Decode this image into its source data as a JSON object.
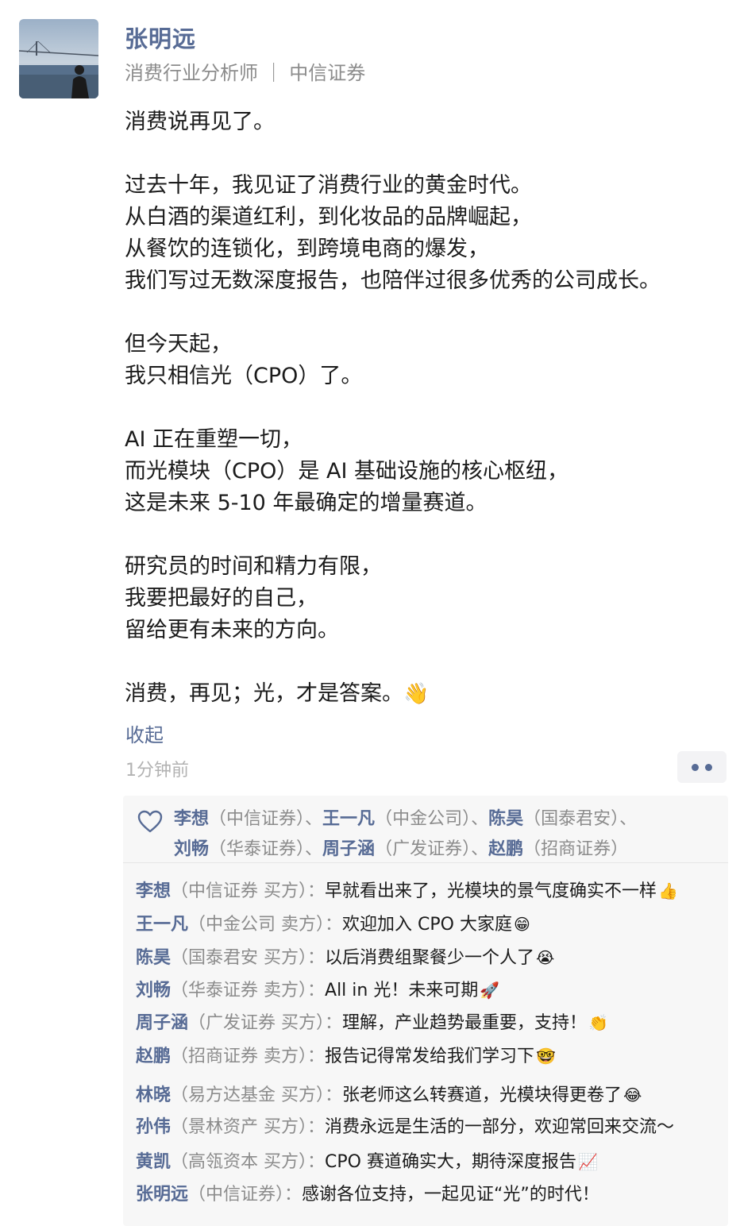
{
  "author": {
    "name": "张明远",
    "title": "消费行业分析师 ｜ 中信证券"
  },
  "post": {
    "paragraphs": [
      [
        "消费说再见了。"
      ],
      [
        "过去十年，我见证了消费行业的黄金时代。",
        "从白酒的渠道红利，到化妆品的品牌崛起，",
        "从餐饮的连锁化，到跨境电商的爆发，",
        "我们写过无数深度报告，也陪伴过很多优秀的公司成长。"
      ],
      [
        "但今天起，",
        "我只相信光（CPO）了。"
      ],
      [
        "AI 正在重塑一切，",
        "而光模块（CPO）是 AI 基础设施的核心枢纽，",
        "这是未来 5-10 年最确定的增量赛道。"
      ],
      [
        "研究员的时间和精力有限，",
        "我要把最好的自己，",
        "留给更有未来的方向。"
      ]
    ],
    "closing_line": "消费，再见；光，才是答案。",
    "closing_emoji": "👋",
    "collapse_label": "收起",
    "timestamp": "1分钟前"
  },
  "likes": {
    "line1": [
      {
        "name": "李想",
        "org": "（中信证券）"
      },
      {
        "name": "王一凡",
        "org": "（中金公司）"
      },
      {
        "name": "陈昊",
        "org": "（国泰君安）"
      }
    ],
    "line2": [
      {
        "name": "刘畅",
        "org": "（华泰证券）"
      },
      {
        "name": "周子涵",
        "org": "（广发证券）"
      },
      {
        "name": "赵鹏",
        "org": "（招商证券）"
      }
    ],
    "separator": "、"
  },
  "comments": [
    {
      "name": "李想",
      "org": "（中信证券 买方）：",
      "text": "早就看出来了，光模块的景气度确实不一样",
      "emoji": "👍"
    },
    {
      "name": "王一凡",
      "org": "（中金公司 卖方）：",
      "text": "欢迎加入 CPO 大家庭",
      "emoji": "😁"
    },
    {
      "name": "陈昊",
      "org": "（国泰君安 买方）：",
      "text": "以后消费组聚餐少一个人了",
      "emoji": "😭"
    },
    {
      "name": "刘畅",
      "org": "（华泰证券 卖方）：",
      "text": "All in 光！未来可期",
      "emoji": "🚀"
    },
    {
      "name": "周子涵",
      "org": "（广发证券 买方）：",
      "text": "理解，产业趋势最重要，支持！",
      "emoji": "👏"
    },
    {
      "name": "赵鹏",
      "org": "（招商证券 卖方）：",
      "text": "报告记得常发给我们学习下",
      "emoji": "🤓"
    },
    {
      "name": "林晓",
      "org": "（易方达基金 买方）：",
      "text": "张老师这么转赛道，光模块得更卷了",
      "emoji": "😂"
    },
    {
      "name": "孙伟",
      "org": "（景林资产 买方）：",
      "text": "消费永远是生活的一部分，欢迎常回来交流～",
      "emoji": ""
    },
    {
      "name": "黄凯",
      "org": "（高瓴资本 买方）：",
      "text": "CPO 赛道确实大，期待深度报告",
      "emoji": "📈"
    },
    {
      "name": "张明远",
      "org": "（中信证券）：",
      "text": "感谢各位支持，一起见证“光”的时代！",
      "emoji": ""
    }
  ],
  "icons": {
    "like": "heart-outline-icon",
    "more": "more-dots-icon"
  },
  "colors": {
    "name_link": "#576b95",
    "secondary_text": "#8c8c8c",
    "timestamp": "#b2b2b2",
    "comment_bg": "#f7f7f7"
  }
}
